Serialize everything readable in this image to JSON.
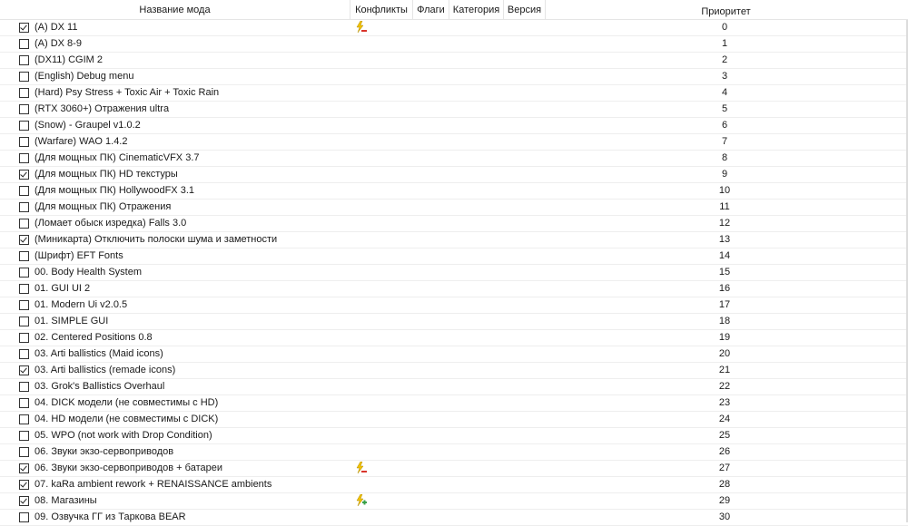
{
  "headers": {
    "name": "Название мода",
    "conflicts": "Конфликты",
    "flags": "Флаги",
    "category": "Категория",
    "version": "Версия",
    "priority": "Приоритет"
  },
  "colors": {
    "conflict_red": "#d9342b",
    "conflict_green": "#3aa14a",
    "conflict_yellow": "#f2c200"
  },
  "mods": [
    {
      "name": "(A) DX 11",
      "checked": true,
      "priority": "0",
      "conflict": "conflict-overwritten-icon"
    },
    {
      "name": "(A) DX 8-9",
      "checked": false,
      "priority": "1",
      "conflict": ""
    },
    {
      "name": "(DX11) CGIM 2",
      "checked": false,
      "priority": "2",
      "conflict": ""
    },
    {
      "name": "(English) Debug menu",
      "checked": false,
      "priority": "3",
      "conflict": ""
    },
    {
      "name": "(Hard) Psy Stress + Toxic Air + Toxic Rain",
      "checked": false,
      "priority": "4",
      "conflict": ""
    },
    {
      "name": "(RTX 3060+) Отражения ultra",
      "checked": false,
      "priority": "5",
      "conflict": ""
    },
    {
      "name": "(Snow) - Graupel v1.0.2",
      "checked": false,
      "priority": "6",
      "conflict": ""
    },
    {
      "name": "(Warfare) WAO 1.4.2",
      "checked": false,
      "priority": "7",
      "conflict": ""
    },
    {
      "name": "(Для мощных ПК) CinematicVFX 3.7",
      "checked": false,
      "priority": "8",
      "conflict": ""
    },
    {
      "name": "(Для мощных ПК) HD текстуры",
      "checked": true,
      "priority": "9",
      "conflict": ""
    },
    {
      "name": "(Для мощных ПК) HollywoodFX 3.1",
      "checked": false,
      "priority": "10",
      "conflict": ""
    },
    {
      "name": "(Для мощных ПК) Отражения",
      "checked": false,
      "priority": "11",
      "conflict": ""
    },
    {
      "name": "(Ломает обыск изредка) Falls 3.0",
      "checked": false,
      "priority": "12",
      "conflict": ""
    },
    {
      "name": "(Миникарта) Отключить полоски шума и заметности",
      "checked": true,
      "priority": "13",
      "conflict": ""
    },
    {
      "name": "(Шрифт) EFT Fonts",
      "checked": false,
      "priority": "14",
      "conflict": ""
    },
    {
      "name": "00. Body Health System",
      "checked": false,
      "priority": "15",
      "conflict": ""
    },
    {
      "name": "01. GUI UI 2",
      "checked": false,
      "priority": "16",
      "conflict": ""
    },
    {
      "name": "01. Modern Ui v2.0.5",
      "checked": false,
      "priority": "17",
      "conflict": ""
    },
    {
      "name": "01. SIMPLE GUI",
      "checked": false,
      "priority": "18",
      "conflict": ""
    },
    {
      "name": "02. Centered Positions 0.8",
      "checked": false,
      "priority": "19",
      "conflict": ""
    },
    {
      "name": "03. Arti ballistics (Maid icons)",
      "checked": false,
      "priority": "20",
      "conflict": ""
    },
    {
      "name": "03. Arti ballistics (remade icons)",
      "checked": true,
      "priority": "21",
      "conflict": ""
    },
    {
      "name": "03. Grok's Ballistics Overhaul",
      "checked": false,
      "priority": "22",
      "conflict": ""
    },
    {
      "name": "04. DICK модели (не совместимы с HD)",
      "checked": false,
      "priority": "23",
      "conflict": ""
    },
    {
      "name": "04. HD модели (не совместимы с DICK)",
      "checked": false,
      "priority": "24",
      "conflict": ""
    },
    {
      "name": "05. WPO (not work with Drop Condition)",
      "checked": false,
      "priority": "25",
      "conflict": ""
    },
    {
      "name": "06. Звуки экзо-сервоприводов",
      "checked": false,
      "priority": "26",
      "conflict": ""
    },
    {
      "name": "06. Звуки экзо-сервоприводов + батареи",
      "checked": true,
      "priority": "27",
      "conflict": "conflict-overwritten-icon"
    },
    {
      "name": "07. kaRa ambient rework + RENAISSANCE ambients",
      "checked": true,
      "priority": "28",
      "conflict": ""
    },
    {
      "name": "08. Магазины",
      "checked": true,
      "priority": "29",
      "conflict": "conflict-overwrites-icon"
    },
    {
      "name": "09. Озвучка ГГ из Таркова BEAR",
      "checked": false,
      "priority": "30",
      "conflict": ""
    }
  ]
}
